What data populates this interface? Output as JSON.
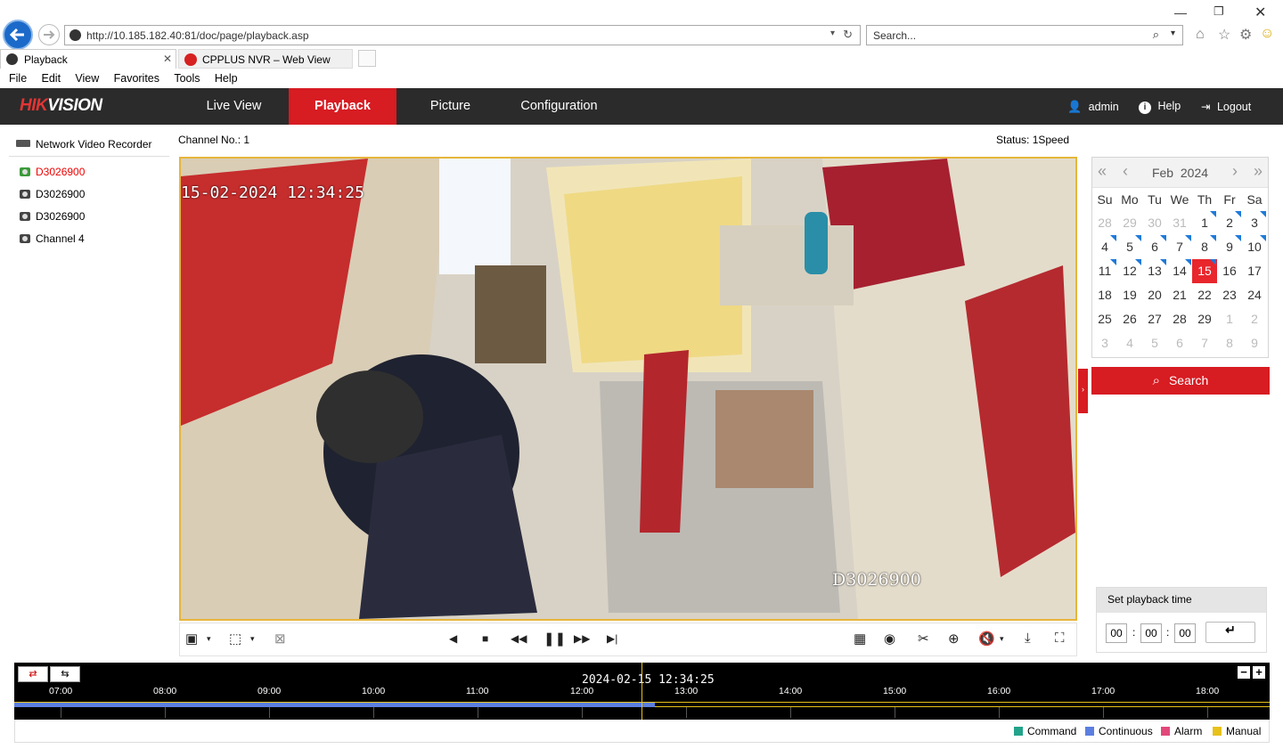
{
  "browser": {
    "address": "http://10.185.182.40:81/doc/page/playback.asp",
    "search_placeholder": "Search...",
    "tabs": [
      {
        "label": "Playback"
      },
      {
        "label": "CPPLUS NVR – Web View"
      }
    ],
    "menu": [
      "File",
      "Edit",
      "View",
      "Favorites",
      "Tools",
      "Help"
    ]
  },
  "header": {
    "logo_a": "HIK",
    "logo_b": "VISION",
    "nav": [
      "Live View",
      "Playback",
      "Picture",
      "Configuration"
    ],
    "active_nav": "Playback",
    "user": "admin",
    "help": "Help",
    "logout": "Logout"
  },
  "tree": {
    "root": "Network Video Recorder",
    "channels": [
      "D3026900",
      "D3026900",
      "D3026900",
      "Channel 4"
    ],
    "active_index": 0
  },
  "player": {
    "channel_label": "Channel No.: 1",
    "status_label": "Status: 1Speed",
    "osd_timestamp": "15-02-2024 12:34:25",
    "osd_camera": "D3026900"
  },
  "calendar": {
    "month": "Feb",
    "year": "2024",
    "dow": [
      "Su",
      "Mo",
      "Tu",
      "We",
      "Th",
      "Fr",
      "Sa"
    ],
    "rows": [
      [
        {
          "d": "28",
          "o": true
        },
        {
          "d": "29",
          "o": true
        },
        {
          "d": "30",
          "o": true
        },
        {
          "d": "31",
          "o": true
        },
        {
          "d": "1",
          "r": true
        },
        {
          "d": "2",
          "r": true
        },
        {
          "d": "3",
          "r": true
        }
      ],
      [
        {
          "d": "4",
          "r": true
        },
        {
          "d": "5",
          "r": true
        },
        {
          "d": "6",
          "r": true
        },
        {
          "d": "7",
          "r": true
        },
        {
          "d": "8",
          "r": true
        },
        {
          "d": "9",
          "r": true
        },
        {
          "d": "10",
          "r": true
        }
      ],
      [
        {
          "d": "11",
          "r": true
        },
        {
          "d": "12",
          "r": true
        },
        {
          "d": "13",
          "r": true
        },
        {
          "d": "14",
          "r": true
        },
        {
          "d": "15",
          "r": true,
          "s": true
        },
        {
          "d": "16"
        },
        {
          "d": "17"
        }
      ],
      [
        {
          "d": "18"
        },
        {
          "d": "19"
        },
        {
          "d": "20"
        },
        {
          "d": "21"
        },
        {
          "d": "22"
        },
        {
          "d": "23"
        },
        {
          "d": "24"
        }
      ],
      [
        {
          "d": "25"
        },
        {
          "d": "26"
        },
        {
          "d": "27"
        },
        {
          "d": "28"
        },
        {
          "d": "29"
        },
        {
          "d": "1",
          "o": true
        },
        {
          "d": "2",
          "o": true
        }
      ],
      [
        {
          "d": "3",
          "o": true
        },
        {
          "d": "4",
          "o": true
        },
        {
          "d": "5",
          "o": true
        },
        {
          "d": "6",
          "o": true
        },
        {
          "d": "7",
          "o": true
        },
        {
          "d": "8",
          "o": true
        },
        {
          "d": "9",
          "o": true
        }
      ]
    ],
    "search_label": "Search"
  },
  "playback_time": {
    "title": "Set playback time",
    "hh": "00",
    "mm": "00",
    "ss": "00"
  },
  "timeline": {
    "current": "2024-02-15 12:34:25",
    "ticks": [
      "07:00",
      "08:00",
      "09:00",
      "10:00",
      "11:00",
      "12:00",
      "13:00",
      "14:00",
      "15:00",
      "16:00",
      "17:00",
      "18:00"
    ]
  },
  "legend": [
    {
      "label": "Command",
      "color": "#22a38a"
    },
    {
      "label": "Continuous",
      "color": "#5b7fe0"
    },
    {
      "label": "Alarm",
      "color": "#e2487a"
    },
    {
      "label": "Manual",
      "color": "#e8c11a"
    }
  ],
  "colors": {
    "accent": "#d71c22",
    "selected": "#e8262c",
    "record_marker": "#1e7ad9"
  }
}
